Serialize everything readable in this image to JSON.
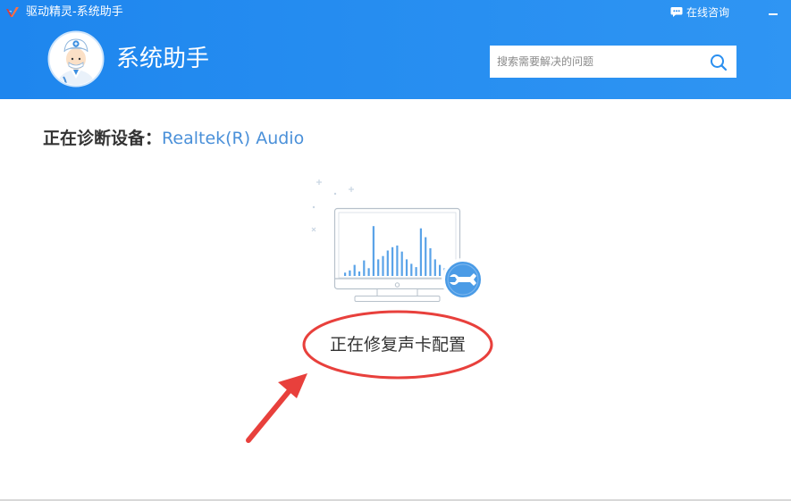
{
  "titlebar": {
    "title": "驱动精灵-系统助手",
    "consult_label": "在线咨询",
    "icons": {
      "app": "driver-genius-logo-icon",
      "consult": "chat-bubble-icon",
      "minimize": "minimize-icon"
    }
  },
  "header": {
    "page_title": "系统助手",
    "avatar_icon": "doctor-avatar-icon"
  },
  "search": {
    "placeholder": "搜索需要解决的问题",
    "icon": "search-icon"
  },
  "diagnosis": {
    "label": "正在诊断设备",
    "colon": "：",
    "device": "Realtek(R) Audio"
  },
  "status": {
    "text": "正在修复声卡配置",
    "icon": "monitor-audio-repair-icon"
  },
  "colors": {
    "header_blue": "#2a8ff0",
    "device_blue": "#4a90d9",
    "annotation_red": "#e8403c"
  },
  "equalizer_levels": [
    0.06,
    0.1,
    0.2,
    0.08,
    0.28,
    0.14,
    0.9,
    0.3,
    0.36,
    0.46,
    0.52,
    0.55,
    0.44,
    0.3,
    0.22,
    0.16,
    0.86,
    0.7,
    0.5,
    0.3,
    0.2,
    0.14
  ]
}
